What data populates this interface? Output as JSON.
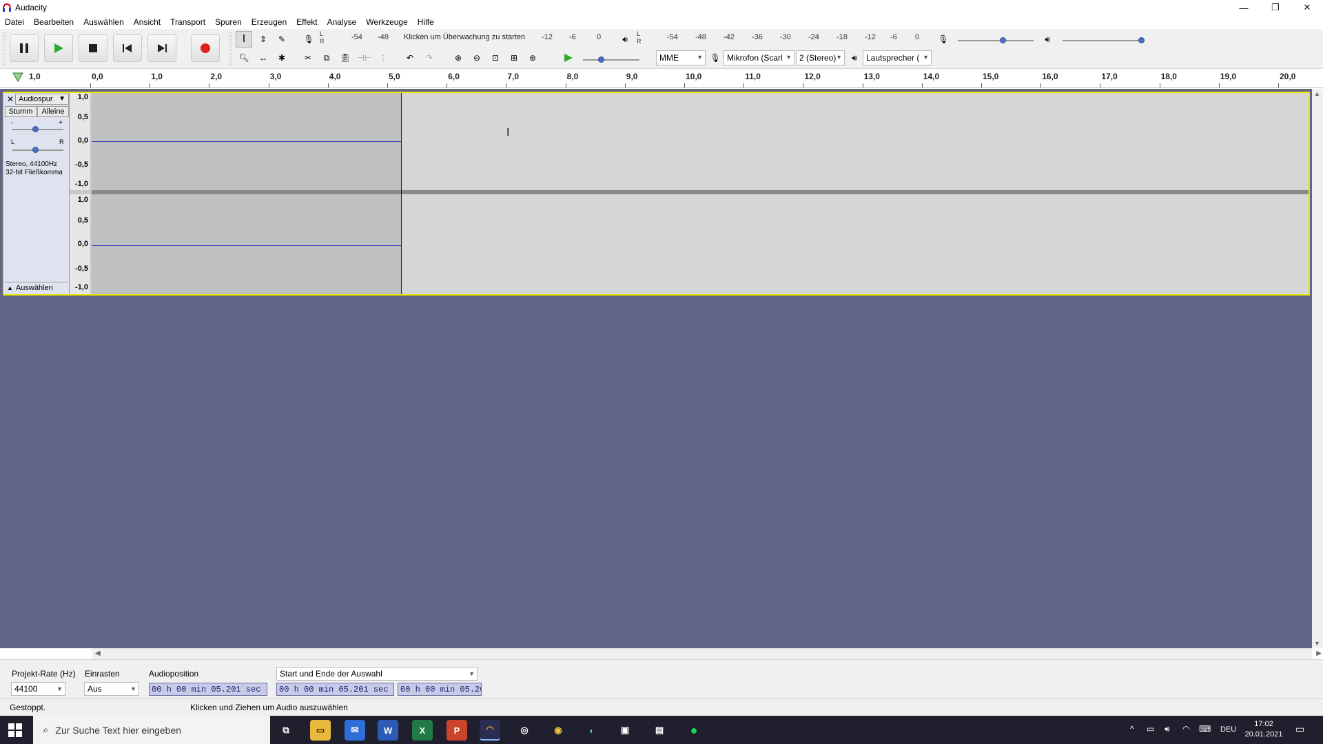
{
  "window": {
    "title": "Audacity"
  },
  "menu": [
    "Datei",
    "Bearbeiten",
    "Auswählen",
    "Ansicht",
    "Transport",
    "Spuren",
    "Erzeugen",
    "Effekt",
    "Analyse",
    "Werkzeuge",
    "Hilfe"
  ],
  "meters": {
    "record_hint": "Klicken um Überwachung zu starten",
    "record_ticks": [
      "-54",
      "-48",
      "-12",
      "-6",
      "0"
    ],
    "play_ticks": [
      "-54",
      "-48",
      "-42",
      "-36",
      "-30",
      "-24",
      "-18",
      "-12",
      "-6",
      "0"
    ]
  },
  "device": {
    "host": "MME",
    "mic": "Mikrofon (Scarl",
    "channels": "2 (Stereo)",
    "speaker": "Lautsprecher ("
  },
  "ruler": {
    "start": "1,0",
    "ticks": [
      "0,0",
      "1,0",
      "2,0",
      "3,0",
      "4,0",
      "5,0",
      "6,0",
      "7,0",
      "8,0",
      "9,0",
      "10,0",
      "11,0",
      "12,0",
      "13,0",
      "14,0",
      "15,0",
      "16,0",
      "17,0",
      "18,0",
      "19,0",
      "20,0"
    ]
  },
  "track": {
    "name": "Audiospur",
    "mute": "Stumm",
    "solo": "Alleine",
    "gain_minus": "-",
    "gain_plus": "+",
    "pan_left": "L",
    "pan_right": "R",
    "info_line1": "Stereo, 44100Hz",
    "info_line2": "32-bit Fließkomma",
    "select": "Auswählen",
    "scale": [
      "1,0",
      "0,5",
      "0,0",
      "-0,5",
      "-1,0"
    ]
  },
  "selection": {
    "rate_label": "Projekt-Rate (Hz)",
    "rate_value": "44100",
    "snap_label": "Einrasten",
    "snap_value": "Aus",
    "audiopos_label": "Audioposition",
    "audiopos_value": "00 h 00 min 05.201 sec",
    "range_label": "Start und Ende der Auswahl",
    "start_value": "00 h 00 min 05.201 sec",
    "end_value": "00 h 00 min 05.20"
  },
  "status": {
    "state": "Gestoppt.",
    "hint": "Klicken und Ziehen um Audio auszuwählen"
  },
  "taskbar": {
    "search_placeholder": "Zur Suche Text hier eingeben",
    "lang": "DEU",
    "time": "17:02",
    "date": "20.01.2021"
  }
}
